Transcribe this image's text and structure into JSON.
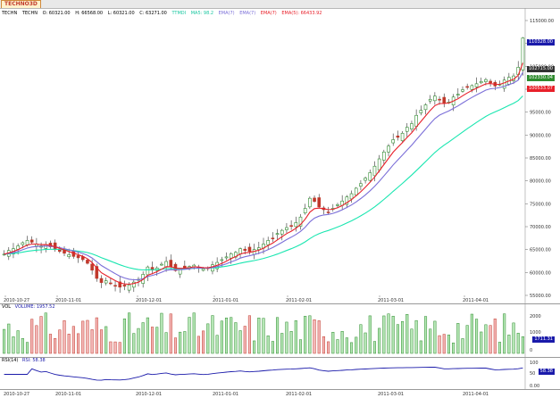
{
  "tab": {
    "label": "TECHNO3D"
  },
  "info": {
    "symbol": "TECHN",
    "exchange": "TECHN",
    "open": "O: 60321.00",
    "high": "H: 66568.00",
    "low": "L: 60321.00",
    "close": "C: 63271.00",
    "vol_label": "TTMDI",
    "ma1": "MA5: 98.2",
    "ma2": "EMA(7)",
    "ma3": "EMA(7)",
    "ma4": "EMA(7)",
    "ma5": "EMA(5): 66433.92"
  },
  "colors": {
    "up": "#2e8b2e",
    "down": "#c0392b",
    "ema_red": "#e8202a",
    "ema_purple": "#7b6fd8",
    "ema_cyan": "#19e6b0",
    "rsi": "#1a1aaa"
  },
  "price_axis": {
    "ticks": [
      "115000.00",
      "110000.00",
      "105000.00",
      "100000.00",
      "95000.00",
      "90000.00",
      "85000.00",
      "80000.00",
      "75000.00",
      "70000.00",
      "65000.00",
      "60000.00",
      "55000.00"
    ]
  },
  "price_badges": [
    {
      "value": "110328.00",
      "bg": "#1a1aaa"
    },
    {
      "value": "102715.00",
      "bg": "#333333"
    },
    {
      "value": "102330.04",
      "bg": "#2e8b2e"
    },
    {
      "value": "100533.07",
      "bg": "#e8202a"
    }
  ],
  "date_axis": {
    "ticks": [
      "2010-10-27",
      "2010-11-01",
      "2010-12-01",
      "2011-01-01",
      "2011-02-01",
      "2011-03-01",
      "2011-04-01"
    ]
  },
  "volume": {
    "label": "VOL",
    "value": "VOLUME: 1957.52",
    "ticks": [
      "2000",
      "1000",
      "0"
    ],
    "badge": "1711.31"
  },
  "rsi": {
    "label": "RSI(14)",
    "value": "RSI: 58.38",
    "ticks": [
      "100",
      "50",
      "0.00"
    ],
    "badge": "58.38"
  },
  "chart_data": {
    "type": "candlestick",
    "note": "approximate daily OHLC readings",
    "start_date": "2010-10-27",
    "end_date": "2011-04-27",
    "ylim": [
      55000,
      115000
    ],
    "closes": [
      64000,
      64800,
      65200,
      65800,
      66500,
      67000,
      66600,
      66200,
      65800,
      66100,
      65600,
      65000,
      64600,
      64200,
      63900,
      63500,
      63200,
      62800,
      62000,
      60500,
      58700,
      57800,
      58200,
      57600,
      57100,
      56800,
      57000,
      57300,
      57900,
      58500,
      59600,
      61200,
      60500,
      61000,
      61800,
      62400,
      61200,
      60400,
      60800,
      61000,
      61300,
      61600,
      61100,
      60800,
      61000,
      61700,
      62200,
      62800,
      63400,
      64100,
      64400,
      65200,
      64800,
      64600,
      65000,
      65400,
      66200,
      67000,
      67500,
      68500,
      69200,
      69800,
      70100,
      70900,
      72100,
      74000,
      76200,
      75500,
      74300,
      73700,
      73200,
      74000,
      74800,
      75600,
      76500,
      77200,
      78400,
      79400,
      80600,
      81800,
      83200,
      84800,
      86300,
      87600,
      89000,
      89500,
      90400,
      91700,
      92500,
      94300,
      95400,
      96600,
      97800,
      98500,
      97800,
      96900,
      97200,
      98300,
      98900,
      99900,
      100400,
      100800,
      101200,
      101700,
      102100,
      101400,
      100700,
      101100,
      102000,
      102600,
      102900,
      104800,
      111200
    ]
  }
}
